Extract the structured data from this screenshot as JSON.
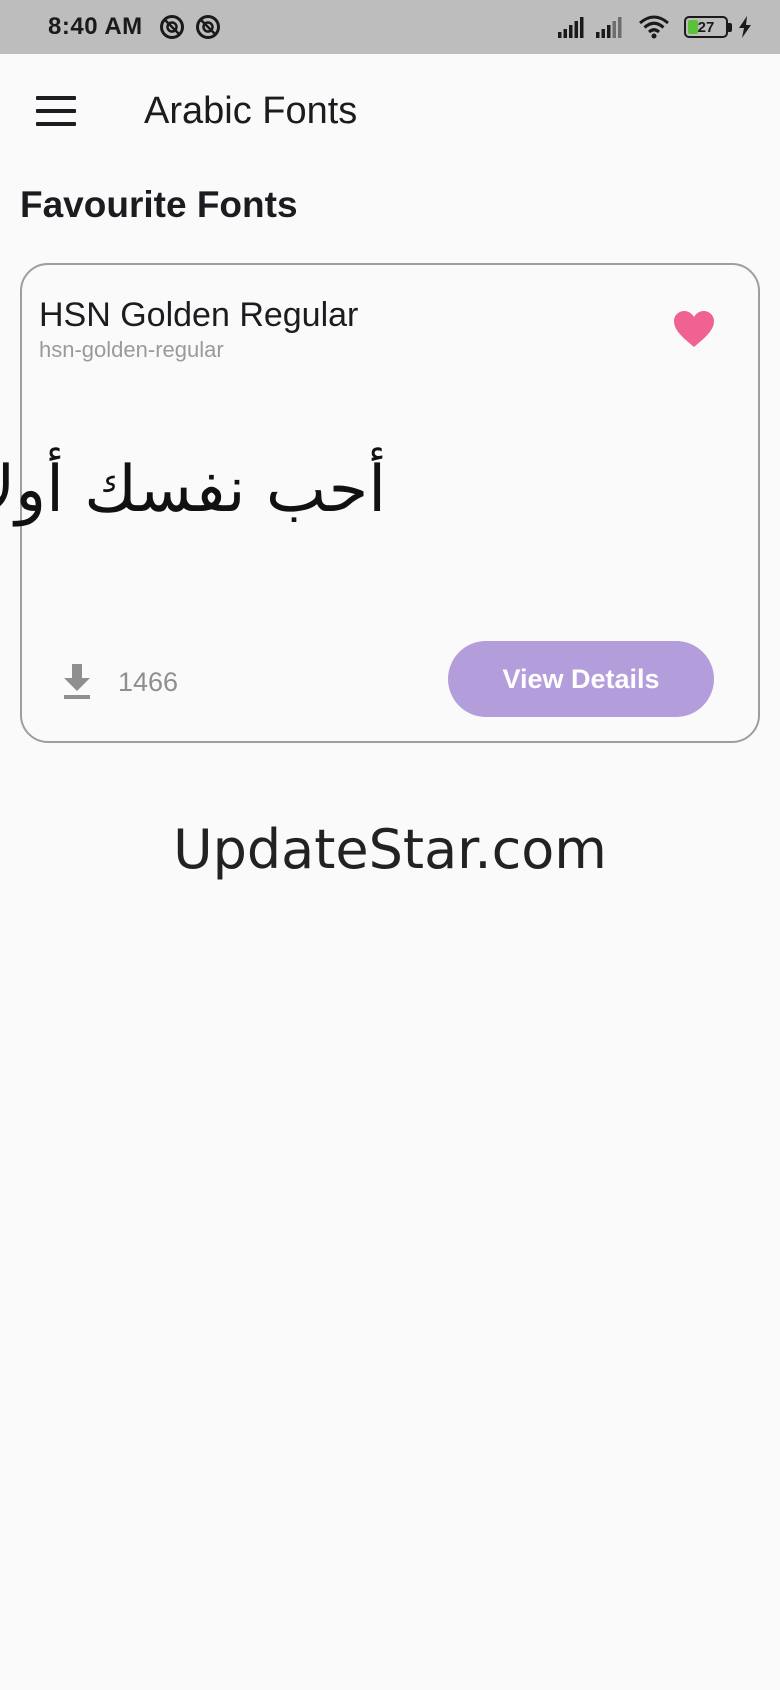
{
  "status_bar": {
    "time": "8:40 AM",
    "battery_level": "27",
    "battery_fraction": 0.27,
    "icons": [
      "dnd-icon",
      "dnd-icon",
      "signal-icon",
      "signal-icon",
      "wifi-icon",
      "battery-icon",
      "charging-icon"
    ]
  },
  "app_bar": {
    "title": "Arabic Fonts",
    "menu_icon": "menu-icon"
  },
  "section": {
    "title": "Favourite Fonts"
  },
  "font_card": {
    "name": "HSN Golden Regular",
    "slug": "hsn-golden-regular",
    "preview_text": "أحب نفسك أولا",
    "favorite_icon": "heart-icon",
    "favorite_color": "#f06292",
    "download_icon": "download-icon",
    "download_count": "1466",
    "view_details_label": "View Details",
    "button_color": "#b39ddb"
  },
  "watermark": {
    "text": "UpdateStar.com"
  }
}
